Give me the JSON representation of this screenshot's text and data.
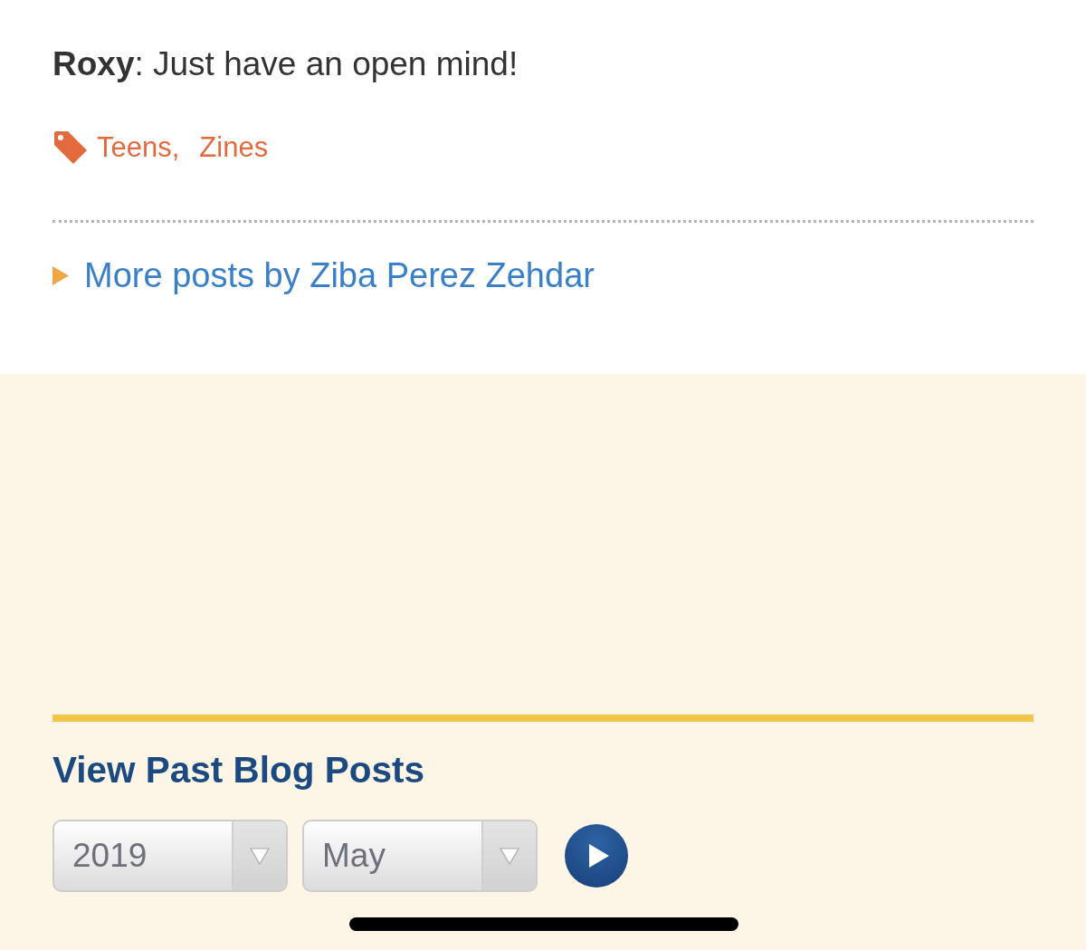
{
  "comment": "**Roxy**: Just have an open mind!",
  "tags": [
    "Teens,",
    "Zines"
  ],
  "more_posts_link": "More posts by Ziba Perez Zehdar",
  "archive": {
    "title": "View Past Blog Posts",
    "dropdowns": [
      {
        "value": "2019"
      },
      {
        "value": "May"
      }
    ]
  }
}
